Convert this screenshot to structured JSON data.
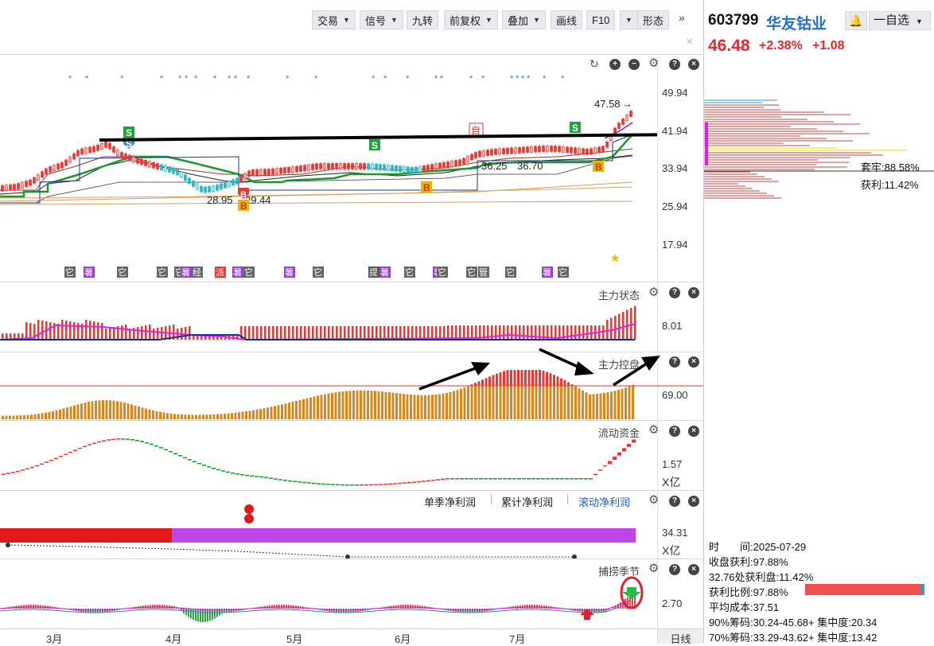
{
  "toolbar": {
    "buttons": [
      {
        "label": "交易",
        "dropdown": true
      },
      {
        "label": "信号",
        "dropdown": true
      },
      {
        "label": "九转",
        "dropdown": false
      },
      {
        "label": "前复权",
        "dropdown": true
      },
      {
        "label": "叠加",
        "dropdown": true
      },
      {
        "label": "画线",
        "dropdown": false
      },
      {
        "label": "F10",
        "dropdown": true
      },
      {
        "label": "形态",
        "dropdown": false
      }
    ],
    "more": "»",
    "close": "×"
  },
  "stock": {
    "code": "603799",
    "name": "华友钴业",
    "price": "46.48",
    "change_pct": "+2.38%",
    "change_abs": "+1.08",
    "watch_label": "自选",
    "watch_prefix": "一",
    "up_color": "#e8262b"
  },
  "main_chart": {
    "y_labels": [
      "49.94",
      "41.94",
      "33.94",
      "25.94",
      "17.94"
    ],
    "annotations": {
      "high_label": "47.58",
      "low_label": "28.95",
      "low_label2": "29.44",
      "mid_label": "36.25",
      "mid_label2": "36.70",
      "self_tag": "自"
    },
    "signal_S": "S",
    "signal_B": "B",
    "tags": [
      "它",
      "薯",
      "它",
      "它",
      "它",
      "薯",
      "经",
      "派",
      "薯",
      "它",
      "薯",
      "它",
      "提",
      "薯",
      "它",
      "薯",
      "它",
      "它",
      "管",
      "它",
      "薯",
      "它"
    ]
  },
  "indicators": {
    "zhuli_zhuangtai": {
      "title": "主力状态",
      "value": "8.01"
    },
    "zhuli_kongpan": {
      "title": "主力控盘",
      "value": "69.00"
    },
    "liudong_zijin": {
      "title": "流动资金",
      "value": "1.57",
      "unit": "X亿"
    },
    "profit": {
      "tabs": [
        "单季净利润",
        "累计净利润",
        "滚动净利润"
      ],
      "value": "34.31",
      "unit": "X亿"
    },
    "bulao": {
      "title": "捕捞季节",
      "value": "2.70"
    }
  },
  "x_axis": {
    "months": [
      "3月",
      "4月",
      "5月",
      "6月",
      "7月"
    ],
    "period": "日线"
  },
  "chip": {
    "taolao": "套牢:88.58%",
    "huoli": "获利:11.42%",
    "stats": [
      "时　　间:2025-07-29",
      "收盘获利:97.88%",
      "32.76处获利盘:11.42%",
      "获利比例:97.88%",
      "平均成本:37.51",
      "90%筹码:30.24-45.68+ 集中度:20.34",
      "70%筹码:33.29-43.62+ 集中度:13.42"
    ],
    "profit_ratio": 0.9788
  }
}
